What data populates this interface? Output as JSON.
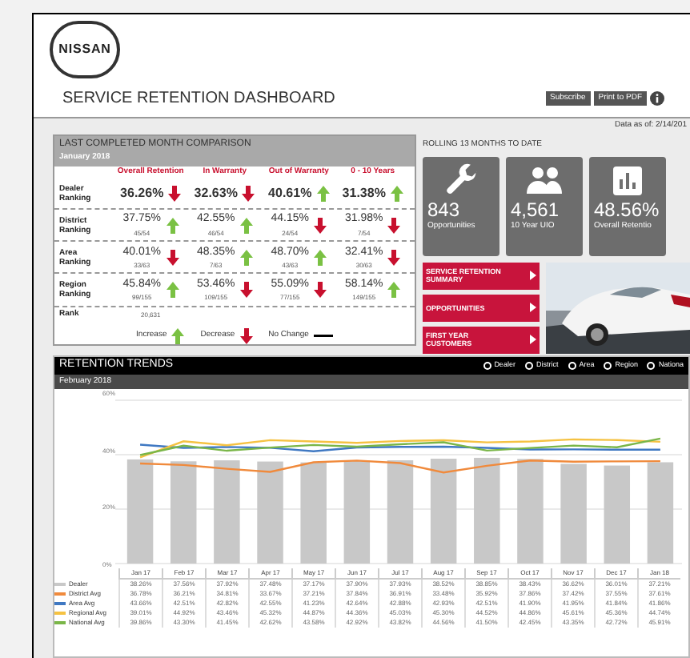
{
  "header": {
    "logo": "NISSAN",
    "title": "SERVICE RETENTION DASHBOARD",
    "buttons": [
      "Subscribe",
      "Print to PDF"
    ],
    "data_as_of": "Data as of: 2/14/201"
  },
  "comparison": {
    "title": "LAST COMPLETED MONTH COMPARISON",
    "subtitle": "January 2018",
    "columns": [
      "Overall Retention",
      "In Warranty",
      "Out of Warranty",
      "0 - 10 Years"
    ],
    "rows": [
      {
        "label": "Dealer Ranking",
        "cells": [
          {
            "value": "36.26%",
            "kind": "down"
          },
          {
            "value": "32.63%",
            "kind": "down"
          },
          {
            "value": "40.61%",
            "kind": "up"
          },
          {
            "value": "31.38%",
            "kind": "up"
          }
        ]
      },
      {
        "label": "District Ranking",
        "cells": [
          {
            "value": "37.75%",
            "rank": "45/54",
            "kind": "up"
          },
          {
            "value": "42.55%",
            "rank": "46/54",
            "kind": "up"
          },
          {
            "value": "44.15%",
            "rank": "24/54",
            "kind": "down"
          },
          {
            "value": "31.98%",
            "rank": "7/54",
            "kind": "down"
          }
        ]
      },
      {
        "label": "Area Ranking",
        "cells": [
          {
            "value": "40.01%",
            "rank": "33/63",
            "kind": "down"
          },
          {
            "value": "48.35%",
            "rank": "7/63",
            "kind": "up"
          },
          {
            "value": "48.70%",
            "rank": "43/63",
            "kind": "up"
          },
          {
            "value": "32.41%",
            "rank": "30/63",
            "kind": "down"
          }
        ]
      },
      {
        "label": "Region Ranking",
        "cells": [
          {
            "value": "45.84%",
            "rank": "99/155",
            "kind": "up"
          },
          {
            "value": "53.46%",
            "rank": "109/155",
            "kind": "down"
          },
          {
            "value": "55.09%",
            "rank": "77/155",
            "kind": "down"
          },
          {
            "value": "58.14%",
            "rank": "149/155",
            "kind": "up"
          }
        ]
      }
    ],
    "rank_row": {
      "label": "Rank",
      "value": "20,631"
    },
    "legend": [
      {
        "label": "Increase",
        "kind": "up"
      },
      {
        "label": "Decrease",
        "kind": "down"
      },
      {
        "label": "No Change",
        "kind": "none"
      }
    ]
  },
  "rolling": {
    "title": "ROLLING 13 MONTHS TO DATE",
    "cards": [
      {
        "kind": "wrench",
        "value": "843",
        "label": "Opportunities"
      },
      {
        "kind": "people",
        "value": "4,561",
        "label": "10 Year UIO"
      },
      {
        "kind": "chart",
        "value": "48.56%",
        "label": "Overall Retentio"
      }
    ],
    "links": [
      "SERVICE RETENTION SUMMARY",
      "OPPORTUNITIES",
      "FIRST YEAR CUSTOMERS"
    ],
    "image": {
      "kind": "picture"
    }
  },
  "trends": {
    "title": "RETENTION TRENDS",
    "options": [
      "Dealer",
      "District",
      "Area",
      "Region",
      "Nationa"
    ],
    "subtitle": "February 2018",
    "yticks": [
      "60%",
      "40%",
      "20%",
      "0%"
    ],
    "months": [
      "Jan 17",
      "Feb 17",
      "Mar 17",
      "Apr 17",
      "May 17",
      "Jun 17",
      "Jul 17",
      "Aug 17",
      "Sep 17",
      "Oct 17",
      "Nov 17",
      "Dec 17",
      "Jan 18"
    ],
    "series": [
      {
        "name": "Dealer",
        "kind": "bar",
        "color": "#c8c8c8",
        "values": [
          "38.26%",
          "37.56%",
          "37.92%",
          "37.48%",
          "37.17%",
          "37.90%",
          "37.93%",
          "38.52%",
          "38.85%",
          "38.43%",
          "36.62%",
          "36.01%",
          "37.21%"
        ]
      },
      {
        "name": "District Avg",
        "kind": "line",
        "color": "#f08a3c",
        "values": [
          "36.78%",
          "36.21%",
          "34.81%",
          "33.67%",
          "37.21%",
          "37.84%",
          "36.91%",
          "33.48%",
          "35.92%",
          "37.86%",
          "37.42%",
          "37.55%",
          "37.61%"
        ]
      },
      {
        "name": "Area Avg",
        "kind": "line",
        "color": "#3f78c2",
        "values": [
          "43.66%",
          "42.51%",
          "42.82%",
          "42.55%",
          "41.23%",
          "42.64%",
          "42.88%",
          "42.93%",
          "42.51%",
          "41.90%",
          "41.95%",
          "41.84%",
          "41.86%"
        ]
      },
      {
        "name": "Regional Avg",
        "kind": "line",
        "color": "#f5c242",
        "values": [
          "39.01%",
          "44.92%",
          "43.46%",
          "45.32%",
          "44.87%",
          "44.36%",
          "45.03%",
          "45.30%",
          "44.52%",
          "44.86%",
          "45.61%",
          "45.36%",
          "44.74%"
        ]
      },
      {
        "name": "National Avg",
        "kind": "line",
        "color": "#7ab648",
        "values": [
          "39.86%",
          "43.30%",
          "41.45%",
          "42.62%",
          "43.58%",
          "42.92%",
          "43.82%",
          "44.56%",
          "41.50%",
          "42.45%",
          "43.35%",
          "42.72%",
          "45.91%"
        ]
      }
    ]
  }
}
